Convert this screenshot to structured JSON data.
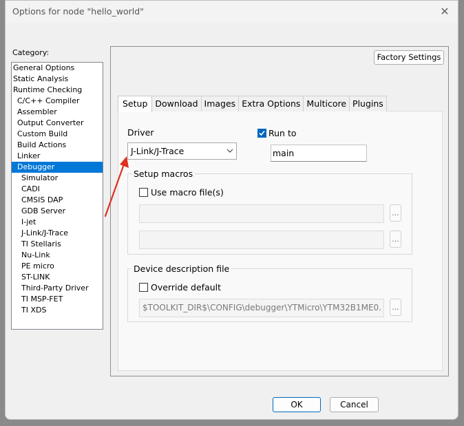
{
  "window": {
    "title": "Options for node \"hello_world\"",
    "close_glyph": "✕"
  },
  "category": {
    "label": "Category:",
    "items": [
      {
        "label": "General Options",
        "level": 0
      },
      {
        "label": "Static Analysis",
        "level": 0
      },
      {
        "label": "Runtime Checking",
        "level": 0
      },
      {
        "label": "C/C++ Compiler",
        "level": 1
      },
      {
        "label": "Assembler",
        "level": 1
      },
      {
        "label": "Output Converter",
        "level": 1
      },
      {
        "label": "Custom Build",
        "level": 1
      },
      {
        "label": "Build Actions",
        "level": 1
      },
      {
        "label": "Linker",
        "level": 1
      },
      {
        "label": "Debugger",
        "level": 1,
        "selected": true
      },
      {
        "label": "Simulator",
        "level": 2
      },
      {
        "label": "CADI",
        "level": 2
      },
      {
        "label": "CMSIS DAP",
        "level": 2
      },
      {
        "label": "GDB Server",
        "level": 2
      },
      {
        "label": "I-jet",
        "level": 2
      },
      {
        "label": "J-Link/J-Trace",
        "level": 2
      },
      {
        "label": "TI Stellaris",
        "level": 2
      },
      {
        "label": "Nu-Link",
        "level": 2
      },
      {
        "label": "PE micro",
        "level": 2
      },
      {
        "label": "ST-LINK",
        "level": 2
      },
      {
        "label": "Third-Party Driver",
        "level": 2
      },
      {
        "label": "TI MSP-FET",
        "level": 2
      },
      {
        "label": "TI XDS",
        "level": 2
      }
    ]
  },
  "factory_settings_label": "Factory Settings",
  "tabs": [
    "Setup",
    "Download",
    "Images",
    "Extra Options",
    "Multicore",
    "Plugins"
  ],
  "active_tab": "Setup",
  "setup": {
    "driver_label": "Driver",
    "driver_value": "J-Link/J-Trace",
    "run_to": {
      "label": "Run to",
      "checked": true,
      "value": "main"
    },
    "setup_macros": {
      "title": "Setup macros",
      "use_macro_label": "Use macro file(s)",
      "use_macro_checked": false,
      "field1": "",
      "field2": ""
    },
    "device_description": {
      "title": "Device description file",
      "override_label": "Override default",
      "override_checked": false,
      "path": "$TOOLKIT_DIR$\\CONFIG\\debugger\\YTMicro\\YTM32B1ME0."
    }
  },
  "browse_label": "...",
  "ok_label": "OK",
  "cancel_label": "Cancel",
  "colors": {
    "accent": "#0078d7",
    "annotation_arrow": "#e0301e"
  }
}
